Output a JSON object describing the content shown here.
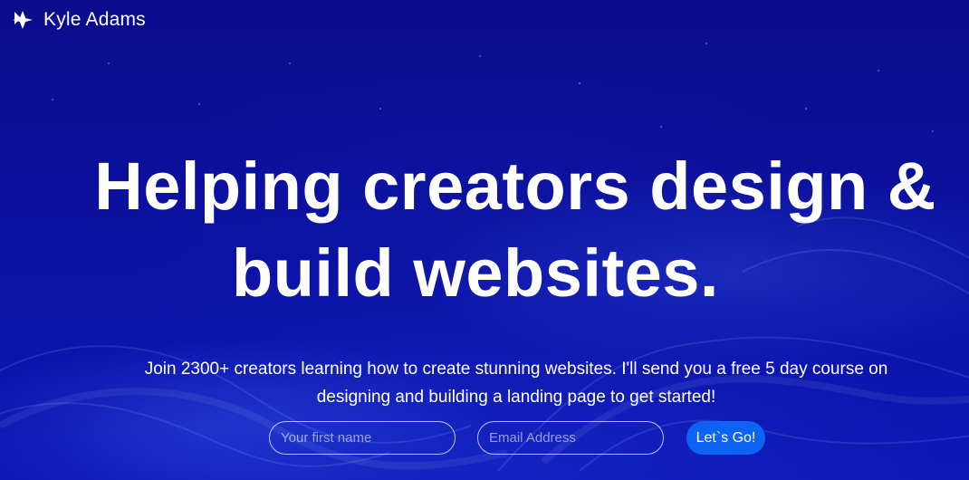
{
  "brand": {
    "name": "Kyle Adams",
    "icon": "diamond-star-logo-icon"
  },
  "hero": {
    "title_line1": "Helping creators design &",
    "title_line2": "build websites."
  },
  "intro": {
    "text": "Join 2300+ creators learning how to create stunning websites. I'll send you a free 5 day course on designing and building a landing page to get started!"
  },
  "form": {
    "first_name_placeholder": "Your first name",
    "email_placeholder": "Email Address",
    "submit_label": "Let`s Go!"
  },
  "colors": {
    "background": "#0b0f96",
    "accent": "#0d64f4",
    "text": "#ffffff"
  }
}
